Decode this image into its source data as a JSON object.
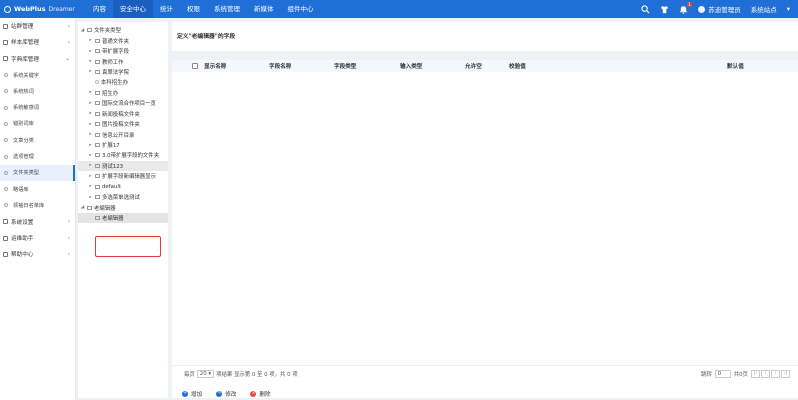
{
  "header": {
    "logo_text": "WebPlus",
    "logo_sub": "Dreamer",
    "nav": [
      "内容",
      "安全中心",
      "统计",
      "权限",
      "系统管理",
      "新媒体",
      "组件中心"
    ],
    "active_nav": 1,
    "badge_count": "1",
    "user_name": "苏迪管理员",
    "site": "系统站点"
  },
  "sidebar": {
    "items": [
      {
        "label": "站群管理",
        "type": "top",
        "arrow": "›"
      },
      {
        "label": "样本库管理",
        "type": "top",
        "arrow": "›"
      },
      {
        "label": "字典库管理",
        "type": "top",
        "arrow": "⌄"
      },
      {
        "label": "系统关键字",
        "type": "sub"
      },
      {
        "label": "系统热词",
        "type": "sub"
      },
      {
        "label": "系统敏感词",
        "type": "sub"
      },
      {
        "label": "错别词库",
        "type": "sub"
      },
      {
        "label": "文章分类",
        "type": "sub"
      },
      {
        "label": "选项管理",
        "type": "sub"
      },
      {
        "label": "文件夹类型",
        "type": "sub",
        "active": true
      },
      {
        "label": "略语库",
        "type": "sub"
      },
      {
        "label": "领袖日名单库",
        "type": "sub"
      },
      {
        "label": "系统设置",
        "type": "top",
        "arrow": "›"
      },
      {
        "label": "运维助手",
        "type": "top",
        "arrow": "›"
      },
      {
        "label": "帮助中心",
        "type": "top",
        "arrow": "›"
      }
    ]
  },
  "tree": {
    "nodes": [
      {
        "label": "文件夹类型",
        "level": 0,
        "toggle": "◢",
        "kind": "folder"
      },
      {
        "label": "普通文件夹",
        "level": 1,
        "toggle": "▸",
        "kind": "folder"
      },
      {
        "label": "带扩展字段",
        "level": 1,
        "toggle": "▸",
        "kind": "folder"
      },
      {
        "label": "教师工作",
        "level": 1,
        "toggle": "▸",
        "kind": "folder"
      },
      {
        "label": "袁翠法学院",
        "level": 1,
        "toggle": "▸",
        "kind": "folder"
      },
      {
        "label": "本科招生办",
        "level": 1,
        "toggle": "",
        "kind": "leaf"
      },
      {
        "label": "招生办",
        "level": 1,
        "toggle": "▸",
        "kind": "folder"
      },
      {
        "label": "国际交流合作项目一览",
        "level": 1,
        "toggle": "▸",
        "kind": "folder"
      },
      {
        "label": "新闻投稿文件夹",
        "level": 1,
        "toggle": "▸",
        "kind": "folder"
      },
      {
        "label": "图片投稿文件夹",
        "level": 1,
        "toggle": "▸",
        "kind": "folder"
      },
      {
        "label": "信息公开目录",
        "level": 1,
        "toggle": "▸",
        "kind": "folder"
      },
      {
        "label": "扩展17",
        "level": 1,
        "toggle": "▸",
        "kind": "folder"
      },
      {
        "label": "3.0带扩展字段的文件夹",
        "level": 1,
        "toggle": "▸",
        "kind": "folder"
      },
      {
        "label": "测试123",
        "level": 1,
        "toggle": "▸",
        "kind": "folder",
        "hl": true
      },
      {
        "label": "扩展字段新编辑器显示",
        "level": 1,
        "toggle": "▸",
        "kind": "folder"
      },
      {
        "label": "default",
        "level": 1,
        "toggle": "▸",
        "kind": "folder"
      },
      {
        "label": "多选菜单选测试",
        "level": 1,
        "toggle": "▸",
        "kind": "folder"
      },
      {
        "label": "老编辑器",
        "level": 0,
        "toggle": "◢",
        "kind": "folder"
      },
      {
        "label": "老编辑器",
        "level": 1,
        "toggle": "",
        "kind": "folder",
        "selected": true
      }
    ]
  },
  "main": {
    "title": "定义\"老编辑器\"的字段",
    "columns": [
      "显示名称",
      "字段名称",
      "字段类型",
      "输入类型",
      "允许空",
      "校验值",
      "默认值"
    ]
  },
  "pager": {
    "per_page_label": "每页",
    "per_page": "20",
    "result_text": "项结果 显示第 0 至 0 项，共 0 项",
    "jump_label": "跳转",
    "jump_value": "0",
    "total_pages": "共0页",
    "buttons": [
      "|‹",
      "‹",
      "›",
      "›|"
    ]
  },
  "footer": {
    "buttons": [
      {
        "label": "增加",
        "color": "#1f6fd6",
        "icon": "+"
      },
      {
        "label": "修改",
        "color": "#1f6fd6",
        "icon": "✎"
      },
      {
        "label": "删除",
        "color": "#e5493a",
        "icon": "×"
      }
    ]
  }
}
